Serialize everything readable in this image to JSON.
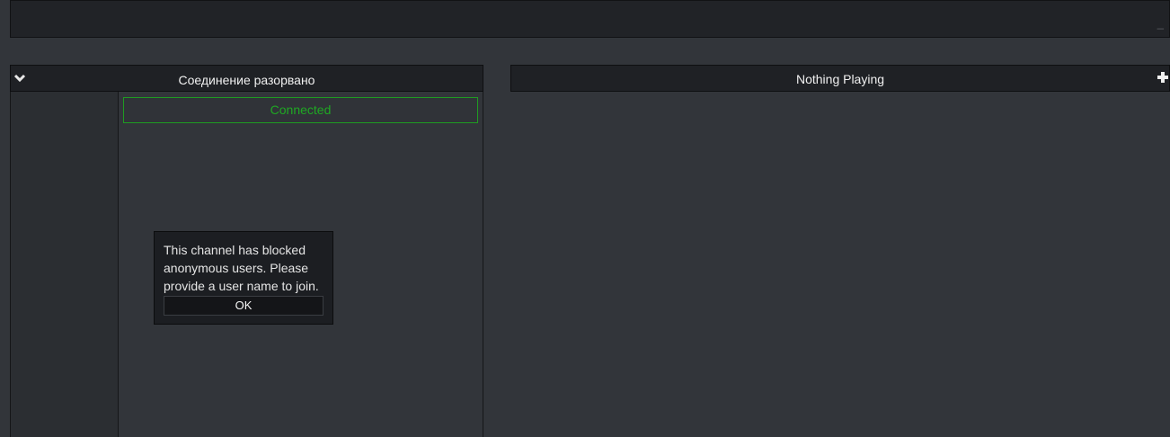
{
  "chat": {
    "status_title": "Соединение разорвано",
    "connected_message": "Connected"
  },
  "dialog": {
    "message": "This channel has blocked anonymous users. Please provide a user name to join.",
    "ok_label": "OK"
  },
  "player": {
    "title": "Nothing Playing"
  },
  "icons": {
    "collapse": "chevron-down-icon",
    "add": "plus-icon",
    "minimize": "minimize-icon"
  },
  "colors": {
    "connected": "#1fa823",
    "panel_header": "#1f2125",
    "background": "#32353a"
  }
}
